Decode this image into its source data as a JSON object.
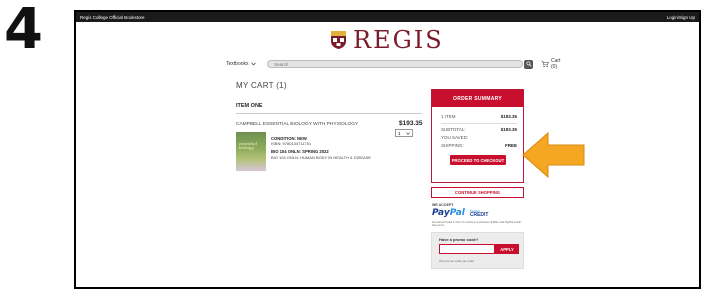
{
  "step": {
    "number": "4"
  },
  "header": {
    "store_name": "Regis College Official Bookstore",
    "account_link": "Login/Sign Up"
  },
  "logo": {
    "text": "REGIS"
  },
  "nav": {
    "textbooks_label": "Textbooks",
    "search_placeholder": "Search",
    "cart_label": "Cart (0)"
  },
  "cart": {
    "title": "MY CART (1)",
    "item_heading": "ITEM ONE",
    "item": {
      "title": "CAMPBELL ESSENTIAL BIOLOGY WITH PHYSIOLOGY",
      "price": "$193.35",
      "quantity": "1",
      "condition": "CONDITION: NEW",
      "isbn": "ISBN: 9780134711751",
      "course": "BIO 104 ONLN: SPRING 2022",
      "course_desc": "BIO 104 ONLN: HUMAN BODY IN HEALTH & DISEASE",
      "cover_title": "essential biology"
    }
  },
  "summary": {
    "heading": "ORDER SUMMARY",
    "item_label": "1 ITEM",
    "item_value": "$193.35",
    "subtotal_label": "SUBTOTAL:",
    "subtotal_value": "$193.35",
    "saved_label": "YOU SAVED:",
    "saved_value": "",
    "shipping_label": "SHIPPING:",
    "shipping_value": "FREE",
    "checkout_label": "PROCEED TO CHECKOUT"
  },
  "continue_label": "CONTINUE SHOPPING",
  "payment": {
    "we_accept": "WE ACCEPT",
    "paypal": "PayPal",
    "paypal_pay": "Pay",
    "paypal_pal": "Pal",
    "credit": "CREDIT",
    "credit_sub": "PayPal",
    "fine_print": "No interest if paid in full in 6 months on purchases of $99+ with PayPal Credit. See terms."
  },
  "promo": {
    "question": "Have a promo code?",
    "apply_label": "APPLY",
    "note": "One promo code per order"
  },
  "colors": {
    "brand": "#c8102e",
    "arrow": "#f5a623",
    "logo": "#7a1b2a"
  }
}
